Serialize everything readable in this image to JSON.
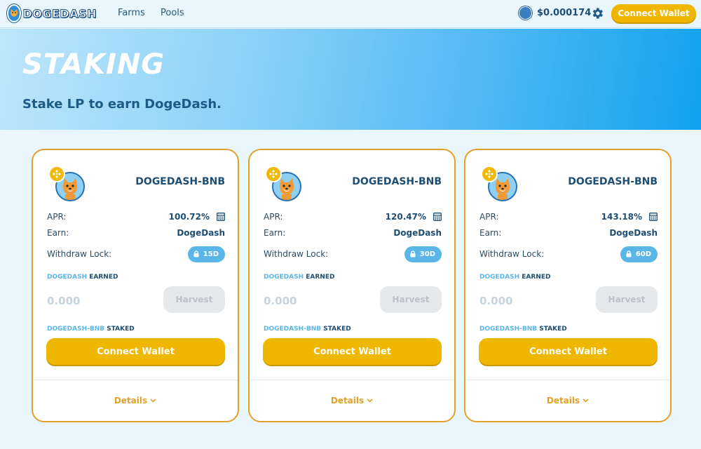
{
  "nav": {
    "logo_text": "DOGEDASH",
    "links": [
      "Farms",
      "Pools"
    ],
    "price": "$0.000174",
    "connect_label": "Connect Wallet"
  },
  "hero": {
    "title": "STAKING",
    "subtitle": "Stake LP to earn DogeDash."
  },
  "colors": {
    "accent": "#efb700",
    "border": "#e0a12a",
    "lock_badge": "#5bb6e8",
    "text_dark": "#1e4e73"
  },
  "cards": [
    {
      "pair": "DOGEDASH-BNB",
      "apr_label": "APR:",
      "apr": "100.72%",
      "earn_label": "Earn:",
      "earn": "DogeDash",
      "lock_label": "Withdraw Lock:",
      "lock": "15D",
      "earned_accent": "DOGEDASH",
      "earned_label": "EARNED",
      "earned_value": "0.000",
      "harvest_label": "Harvest",
      "staked_accent": "DOGEDASH-BNB",
      "staked_label": "STAKED",
      "connect_label": "Connect Wallet",
      "details_label": "Details"
    },
    {
      "pair": "DOGEDASH-BNB",
      "apr_label": "APR:",
      "apr": "120.47%",
      "earn_label": "Earn:",
      "earn": "DogeDash",
      "lock_label": "Withdraw Lock:",
      "lock": "30D",
      "earned_accent": "DOGEDASH",
      "earned_label": "EARNED",
      "earned_value": "0.000",
      "harvest_label": "Harvest",
      "staked_accent": "DOGEDASH-BNB",
      "staked_label": "STAKED",
      "connect_label": "Connect Wallet",
      "details_label": "Details"
    },
    {
      "pair": "DOGEDASH-BNB",
      "apr_label": "APR:",
      "apr": "143.18%",
      "earn_label": "Earn:",
      "earn": "DogeDash",
      "lock_label": "Withdraw Lock:",
      "lock": "60D",
      "earned_accent": "DOGEDASH",
      "earned_label": "EARNED",
      "earned_value": "0.000",
      "harvest_label": "Harvest",
      "staked_accent": "DOGEDASH-BNB",
      "staked_label": "STAKED",
      "connect_label": "Connect Wallet",
      "details_label": "Details"
    }
  ],
  "icons": {
    "logo": "doge-logo-icon",
    "price": "doge-coin-icon",
    "settings": "gear-icon",
    "token": "doge-token-icon",
    "bnb": "bnb-icon",
    "calculator": "calculator-icon",
    "lock": "lock-icon",
    "details": "chevron-down-icon"
  }
}
